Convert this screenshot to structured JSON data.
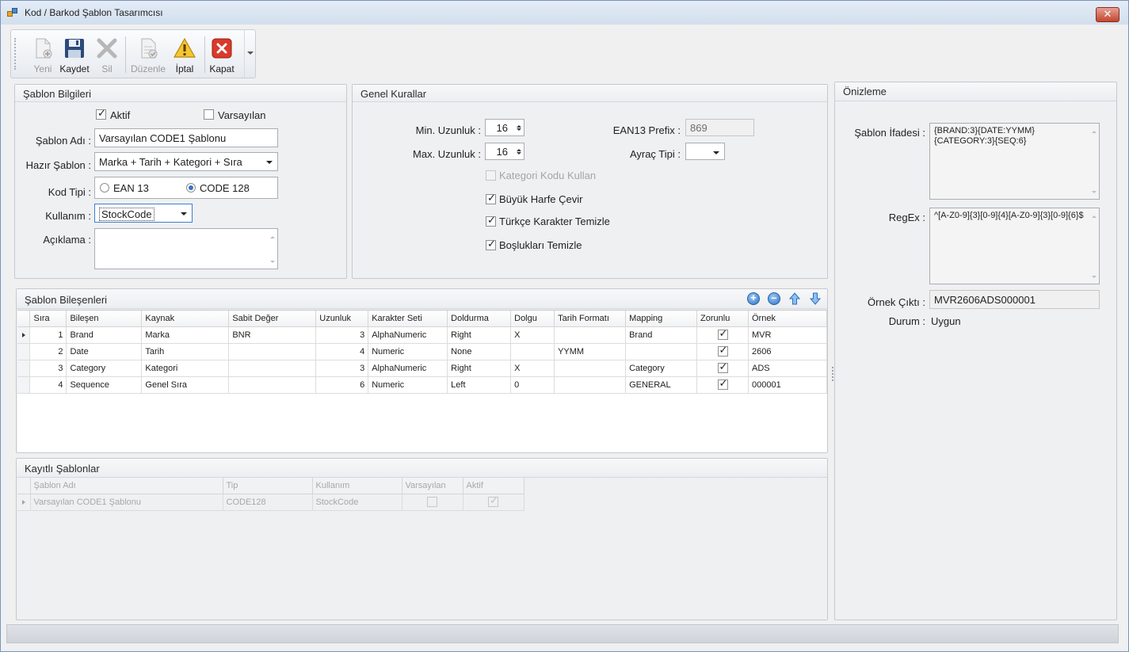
{
  "window": {
    "title": "Kod / Barkod Şablon Tasarımcısı",
    "close": "✕"
  },
  "toolbar": {
    "new": "Yeni",
    "save": "Kaydet",
    "delete": "Sil",
    "edit": "Düzenle",
    "cancel": "İptal",
    "close": "Kapat"
  },
  "template_info": {
    "header": "Şablon Bilgileri",
    "active_label": "Aktif",
    "active": true,
    "default_label": "Varsayılan",
    "default": false,
    "name_label": "Şablon Adı :",
    "name": "Varsayılan CODE1 Şablonu",
    "preset_label": "Hazır Şablon :",
    "preset": "Marka + Tarih + Kategori + Sıra",
    "code_type_label": "Kod Tipi :",
    "ean13_label": "EAN 13",
    "code128_label": "CODE 128",
    "code_type": "CODE 128",
    "usage_label": "Kullanım :",
    "usage": "StockCode",
    "description_label": "Açıklama :",
    "description": ""
  },
  "general_rules": {
    "header": "Genel Kurallar",
    "min_length_label": "Min. Uzunluk :",
    "min_length": "16",
    "max_length_label": "Max. Uzunluk :",
    "max_length": "16",
    "ean13_prefix_label": "EAN13 Prefix :",
    "ean13_prefix": "869",
    "separator_label": "Ayraç Tipi :",
    "separator": "",
    "use_category_code": "Kategori Kodu Kullan",
    "uppercase": "Büyük Harfe Çevir",
    "clean_turkish": "Türkçe Karakter Temizle",
    "trim_spaces": "Boşlukları Temizle"
  },
  "preview": {
    "header": "Önizleme",
    "expression_label": "Şablon İfadesi :",
    "expression": "{BRAND:3}{DATE:YYMM}\n{CATEGORY:3}{SEQ:6}",
    "regex_label": "RegEx :",
    "regex": "^[A-Z0-9]{3}[0-9]{4}[A-Z0-9]{3}[0-9]{6}$",
    "sample_label": "Örnek Çıktı :",
    "sample": "MVR2606ADS000001",
    "status_label": "Durum :",
    "status": "Uygun"
  },
  "components": {
    "header": "Şablon Bileşenleri",
    "columns": [
      "Sıra",
      "Bileşen",
      "Kaynak",
      "Sabit Değer",
      "Uzunluk",
      "Karakter Seti",
      "Doldurma",
      "Dolgu",
      "Tarih Formatı",
      "Mapping",
      "Zorunlu",
      "Örnek"
    ],
    "rows": [
      {
        "order": "1",
        "component": "Brand",
        "source": "Marka",
        "fixed": "BNR",
        "length": "3",
        "charset": "AlphaNumeric",
        "padding": "Right",
        "fill": "X",
        "date_format": "",
        "mapping": "Brand",
        "required": true,
        "sample": "MVR"
      },
      {
        "order": "2",
        "component": "Date",
        "source": "Tarih",
        "fixed": "",
        "length": "4",
        "charset": "Numeric",
        "padding": "None",
        "fill": "",
        "date_format": "YYMM",
        "mapping": "",
        "required": true,
        "sample": "2606"
      },
      {
        "order": "3",
        "component": "Category",
        "source": "Kategori",
        "fixed": "",
        "length": "3",
        "charset": "AlphaNumeric",
        "padding": "Right",
        "fill": "X",
        "date_format": "",
        "mapping": "Category",
        "required": true,
        "sample": "ADS"
      },
      {
        "order": "4",
        "component": "Sequence",
        "source": "Genel Sıra",
        "fixed": "",
        "length": "6",
        "charset": "Numeric",
        "padding": "Left",
        "fill": "0",
        "date_format": "",
        "mapping": "GENERAL",
        "required": true,
        "sample": "000001"
      }
    ]
  },
  "saved": {
    "header": "Kayıtlı Şablonlar",
    "columns": [
      "Şablon Adı",
      "Tip",
      "Kullanım",
      "Varsayılan",
      "Aktif"
    ],
    "rows": [
      {
        "name": "Varsayılan CODE1 Şablonu",
        "type": "CODE128",
        "usage": "StockCode",
        "default": false,
        "active": true
      }
    ]
  }
}
